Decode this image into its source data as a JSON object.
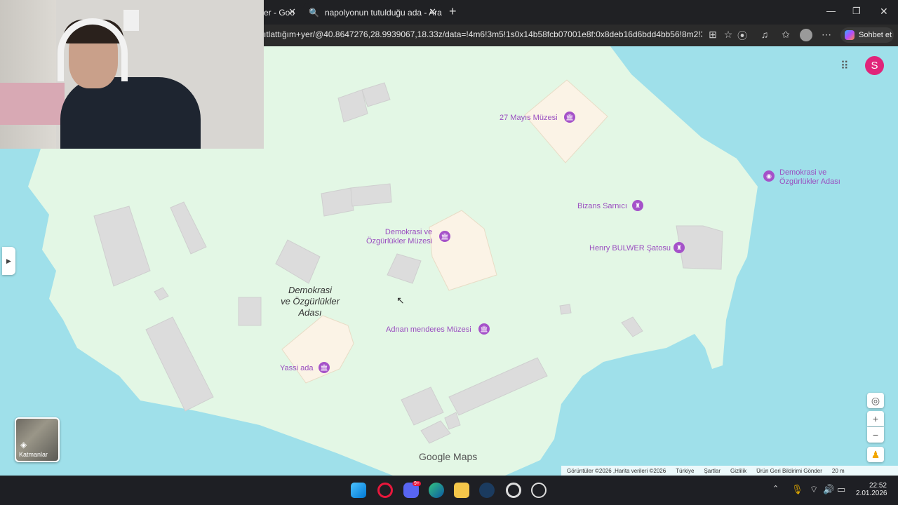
{
  "browser": {
    "tabs": [
      {
        "label": "er - Goo",
        "active": false
      },
      {
        "label": "napolyonun tutulduğu ada - Aram",
        "active": true
      }
    ],
    "url": "ıtlattığım+yer/@40.8647276,28.9939067,18.33z/data=!4m6!3m5!1s0x14b58fcb07001e8f:0x8deb16d6bdd4bb56!8m2!3d...",
    "copilot_label": "Sohbet et",
    "profile_initial": "S"
  },
  "map": {
    "island_label": [
      "Demokrasi",
      "ve Özgürlükler",
      "Adası"
    ],
    "pois": [
      {
        "name": "27 Mayıs Müzesi",
        "icon": "museum-icon"
      },
      {
        "name": "Demokrasi ve\nÖzgürlükler Adası",
        "icon": "camera-icon"
      },
      {
        "name": "Bizans Sarnıcı",
        "icon": "landmark-icon"
      },
      {
        "name": "Demokrasi ve\nÖzgürlükler Müzesi",
        "icon": "museum-icon"
      },
      {
        "name": "Henry BULWER Şatosu",
        "icon": "landmark-icon"
      },
      {
        "name": "Adnan menderes Müzesi",
        "icon": "museum-icon"
      },
      {
        "name": "Yassi ada",
        "icon": "museum-icon"
      }
    ],
    "layers_label": "Katmanlar",
    "logo": "Google Maps",
    "attribution": [
      "Görüntüler ©2026 ,Harita verileri ©2026",
      "Türkiye",
      "Şartlar",
      "Gizlilik",
      "Ürün Geri Bildirimi Gönder",
      "20 m"
    ]
  },
  "taskbar": {
    "time": "22:52",
    "date": "2.01.2026",
    "discord_badge": "9+"
  },
  "colors": {
    "water": "#9fe0ea",
    "land": "#e3f7e5",
    "building": "#dcdcdc",
    "poi": "#a552c9",
    "accent": "#e0247a"
  }
}
